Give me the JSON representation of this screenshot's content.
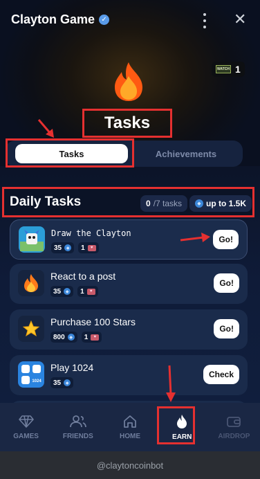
{
  "header": {
    "title": "Clayton Game",
    "badge_count": "1",
    "badge_img_text": "WATCH"
  },
  "page": {
    "title": "Tasks"
  },
  "tabs": {
    "active": "Tasks",
    "other": "Achievements"
  },
  "daily": {
    "title": "Daily Tasks",
    "done": "0",
    "total": "/7 tasks",
    "reward": "up to 1.5K"
  },
  "tasks": [
    {
      "name": "Draw the Clayton",
      "coins": "35",
      "tickets": "1",
      "action": "Go!"
    },
    {
      "name": "React to a post",
      "coins": "35",
      "tickets": "1",
      "action": "Go!"
    },
    {
      "name": "Purchase 100 Stars",
      "coins": "800",
      "tickets": "1",
      "action": "Go!"
    },
    {
      "name": "Play 1024",
      "coins": "35",
      "tile_text": "1024",
      "action": "Check"
    }
  ],
  "nav": [
    {
      "label": "GAMES",
      "icon": "diamond-icon"
    },
    {
      "label": "FRIENDS",
      "icon": "friends-icon"
    },
    {
      "label": "HOME",
      "icon": "home-icon"
    },
    {
      "label": "EARN",
      "icon": "flame-icon"
    },
    {
      "label": "AIRDROP",
      "icon": "wallet-icon"
    }
  ],
  "footer": {
    "text": "@claytoncoinbot"
  },
  "colors": {
    "highlight": "#e53030",
    "accent_blue": "#3b86d8",
    "flame_orange": "#ff6a1a"
  }
}
